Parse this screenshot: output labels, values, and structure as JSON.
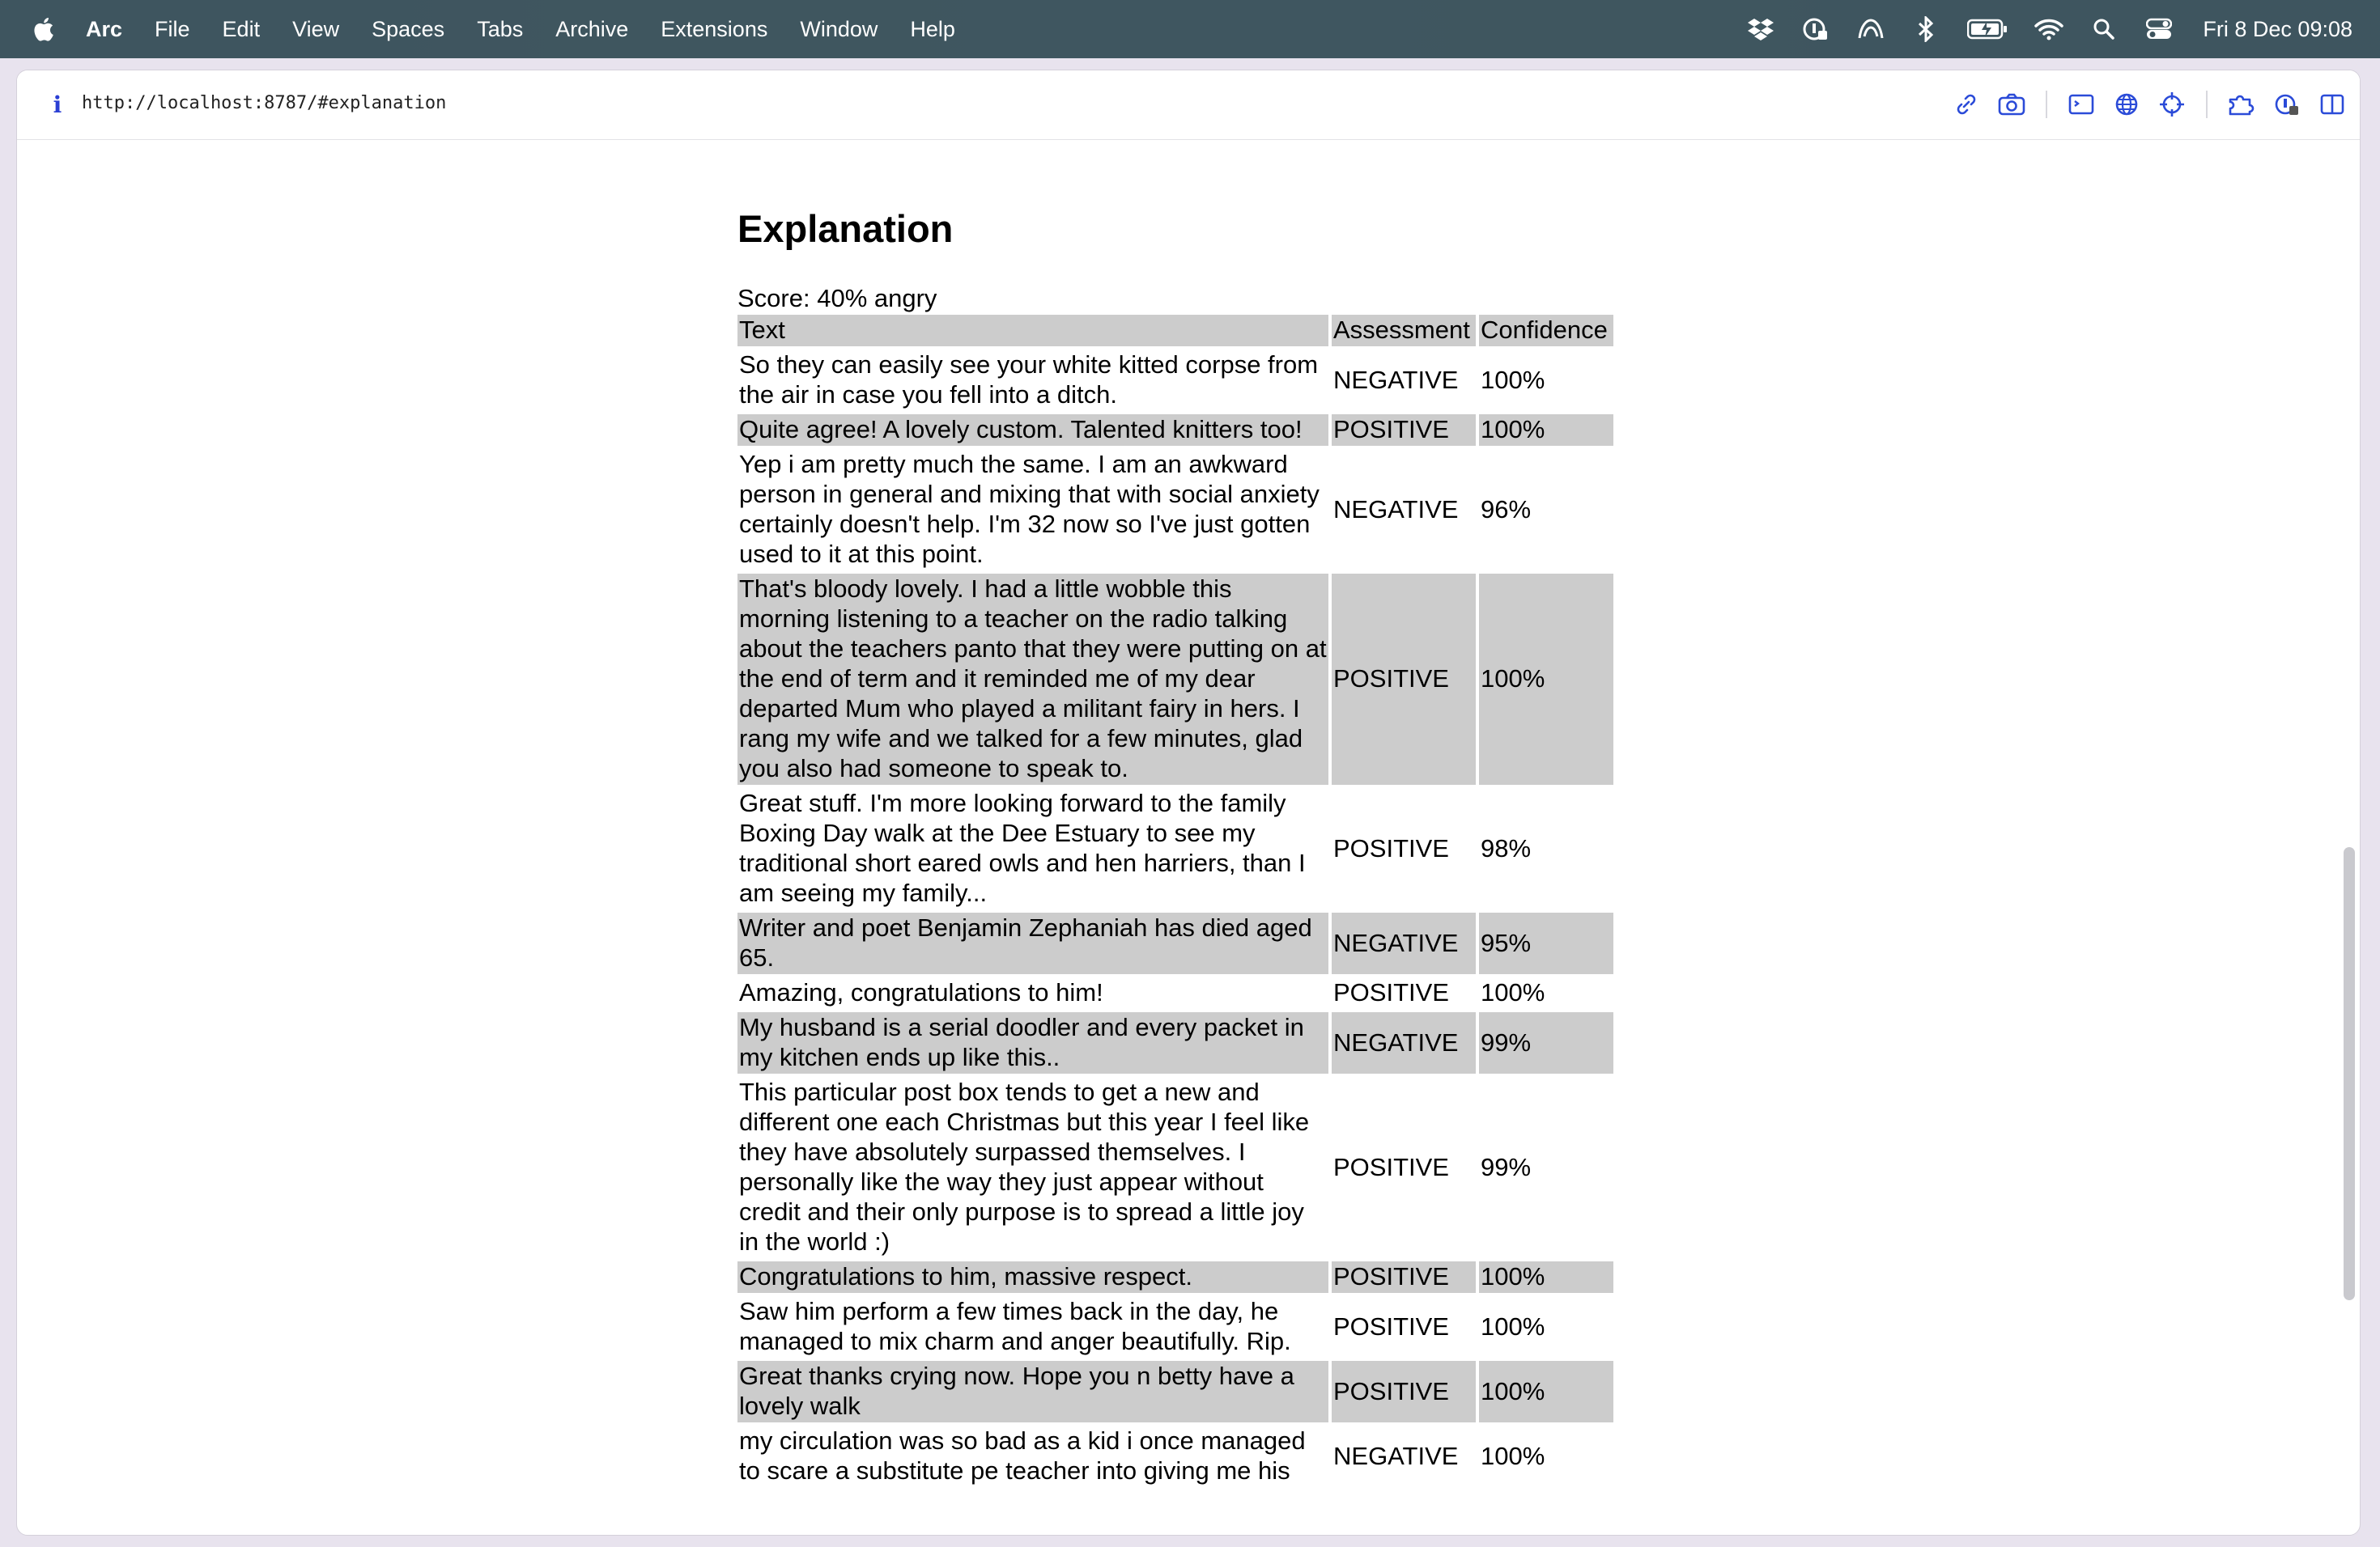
{
  "menubar": {
    "app": "Arc",
    "items": [
      "File",
      "Edit",
      "View",
      "Spaces",
      "Tabs",
      "Archive",
      "Extensions",
      "Window",
      "Help"
    ],
    "clock": "Fri 8 Dec  09:08",
    "status_icons": [
      "dropbox-icon",
      "password-manager-icon",
      "arc-icon",
      "bluetooth-icon",
      "battery-icon",
      "wifi-icon",
      "spotlight-icon",
      "control-center-icon"
    ]
  },
  "browser": {
    "url": "http://localhost:8787/#explanation",
    "tools": [
      "copy-link-icon",
      "screenshot-icon",
      "console-icon",
      "globe-icon",
      "target-icon",
      "extensions-icon",
      "password-manager-icon",
      "sidebar-toggle-icon"
    ]
  },
  "page": {
    "title": "Explanation",
    "score": "Score: 40% angry",
    "table": {
      "headers": [
        "Text",
        "Assessment",
        "Confidence"
      ],
      "rows": [
        {
          "text": "So they can easily see your white kitted corpse from the air in case you fell into a ditch.",
          "assessment": "NEGATIVE",
          "confidence": "100%"
        },
        {
          "text": "Quite agree! A lovely custom. Talented knitters too!",
          "assessment": "POSITIVE",
          "confidence": "100%"
        },
        {
          "text": "Yep i am pretty much the same. I am an awkward person in general and mixing that with social anxiety certainly doesn't help. I'm 32 now so I've just gotten used to it at this point.",
          "assessment": "NEGATIVE",
          "confidence": "96%"
        },
        {
          "text": "That's bloody lovely. I had a little wobble this morning listening to a teacher on the radio talking about the teachers panto that they were putting on at the end of term and it reminded me of my dear departed Mum who played a militant fairy in hers. I rang my wife and we talked for a few minutes, glad you also had someone to speak to.",
          "assessment": "POSITIVE",
          "confidence": "100%"
        },
        {
          "text": "Great stuff. I'm more looking forward to the family Boxing Day walk at the Dee Estuary to see my traditional short eared owls and hen harriers, than I am seeing my family...",
          "assessment": "POSITIVE",
          "confidence": "98%"
        },
        {
          "text": "Writer and poet Benjamin Zephaniah has died aged 65.",
          "assessment": "NEGATIVE",
          "confidence": "95%"
        },
        {
          "text": "Amazing, congratulations to him!",
          "assessment": "POSITIVE",
          "confidence": "100%"
        },
        {
          "text": "My husband is a serial doodler and every packet in my kitchen ends up like this..",
          "assessment": "NEGATIVE",
          "confidence": "99%"
        },
        {
          "text": "This particular post box tends to get a new and different one each Christmas but this year I feel like they have absolutely surpassed themselves. I personally like the way they just appear without credit and their only purpose is to spread a little joy in the world :)",
          "assessment": "POSITIVE",
          "confidence": "99%"
        },
        {
          "text": "Congratulations to him, massive respect.",
          "assessment": "POSITIVE",
          "confidence": "100%"
        },
        {
          "text": "Saw him perform a few times back in the day, he managed to mix charm and anger beautifully. Rip.",
          "assessment": "POSITIVE",
          "confidence": "100%"
        },
        {
          "text": "Great thanks crying now. Hope you n betty have a lovely walk",
          "assessment": "POSITIVE",
          "confidence": "100%"
        },
        {
          "text": "my circulation was so bad as a kid i once managed to scare a substitute pe teacher into giving me his",
          "assessment": "NEGATIVE",
          "confidence": "100%"
        }
      ]
    }
  },
  "colors": {
    "row_alt_bg": "#cccccc",
    "menubar_bg": "#3c525c",
    "info_icon": "#2b3fd4",
    "toolbar_icon": "#2b4bd8"
  }
}
